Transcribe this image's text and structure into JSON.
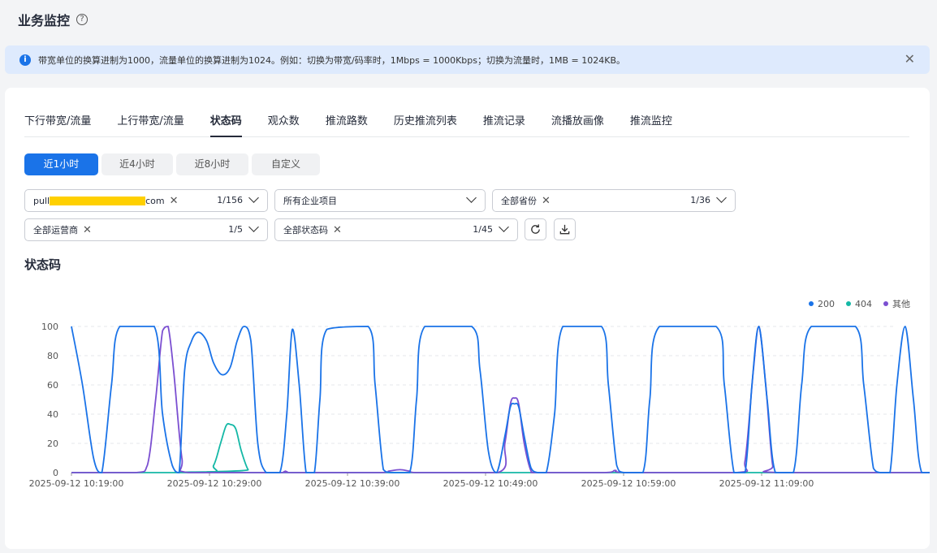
{
  "header": {
    "title": "业务监控",
    "help_icon": "?"
  },
  "notice": {
    "text": "带宽单位的换算进制为1000，流量单位的换算进制为1024。例如：切换为带宽/码率时，1Mbps = 1000Kbps；切换为流量时，1MB = 1024KB。",
    "info_icon": "i",
    "close_icon": "✕"
  },
  "tabs": [
    "下行带宽/流量",
    "上行带宽/流量",
    "状态码",
    "观众数",
    "推流路数",
    "历史推流列表",
    "推流记录",
    "流播放画像",
    "推流监控"
  ],
  "active_tab": "状态码",
  "time_range": {
    "options": [
      "近1小时",
      "近4小时",
      "近8小时",
      "自定义"
    ],
    "active": "近1小时"
  },
  "filters": {
    "domain": {
      "prefix": "pull",
      "suffix": "com",
      "count": "1/156"
    },
    "project": {
      "value": "所有企业项目"
    },
    "province": {
      "value": "全部省份",
      "count": "1/36"
    },
    "isp": {
      "value": "全部运营商",
      "count": "1/5"
    },
    "status_code": {
      "value": "全部状态码",
      "count": "1/45"
    },
    "remove_icon": "✕"
  },
  "chart_title": "状态码",
  "chart_data": {
    "type": "line",
    "ylim": [
      0,
      100
    ],
    "y_ticks": [
      "0",
      "20",
      "40",
      "60",
      "80",
      "100"
    ],
    "x_tick_labels": [
      "2025-09-12 10:19:00",
      "2025-09-12 10:29:00",
      "2025-09-12 10:39:00",
      "2025-09-12 10:49:00",
      "2025-09-12 10:59:00",
      "2025-09-12 11:09:00"
    ],
    "x_minutes_range": [
      0,
      60
    ],
    "grid": "horizontal dashed",
    "legend_position": "top-right",
    "series": [
      {
        "name": "200",
        "color": "#1a73e8",
        "points": [
          [
            0,
            100
          ],
          [
            0.8,
            60
          ],
          [
            1.6,
            10
          ],
          [
            2.2,
            0
          ],
          [
            2.9,
            60
          ],
          [
            3.5,
            100
          ],
          [
            6,
            100
          ],
          [
            6.6,
            40
          ],
          [
            7.3,
            5
          ],
          [
            7.8,
            0
          ],
          [
            8.2,
            70
          ],
          [
            8.7,
            90
          ],
          [
            9.2,
            96
          ],
          [
            9.8,
            90
          ],
          [
            10.3,
            75
          ],
          [
            10.9,
            67
          ],
          [
            11.5,
            72
          ],
          [
            12,
            90
          ],
          [
            12.5,
            100
          ],
          [
            13,
            90
          ],
          [
            13.5,
            20
          ],
          [
            14.1,
            0
          ],
          [
            15.1,
            0
          ],
          [
            15.6,
            40
          ],
          [
            16,
            98
          ],
          [
            16.5,
            60
          ],
          [
            17,
            0
          ],
          [
            17.6,
            0
          ],
          [
            18,
            50
          ],
          [
            18.5,
            98
          ],
          [
            21.5,
            100
          ],
          [
            22,
            60
          ],
          [
            22.6,
            2
          ],
          [
            23.2,
            0
          ],
          [
            24.5,
            0
          ],
          [
            25,
            50
          ],
          [
            25.6,
            100
          ],
          [
            29,
            100
          ],
          [
            29.6,
            70
          ],
          [
            30.2,
            15
          ],
          [
            30.8,
            0
          ],
          [
            31.4,
            25
          ],
          [
            31.8,
            45
          ],
          [
            32.1,
            47
          ],
          [
            32.4,
            45
          ],
          [
            32.8,
            25
          ],
          [
            33.3,
            3
          ],
          [
            33.8,
            0
          ],
          [
            34.4,
            0
          ],
          [
            35,
            40
          ],
          [
            35.6,
            100
          ],
          [
            38.4,
            100
          ],
          [
            38.9,
            60
          ],
          [
            39.5,
            5
          ],
          [
            40,
            0
          ],
          [
            41.4,
            0
          ],
          [
            41.9,
            50
          ],
          [
            42.6,
            100
          ],
          [
            46.7,
            100
          ],
          [
            47.3,
            60
          ],
          [
            48,
            0
          ],
          [
            48.8,
            0
          ],
          [
            49.3,
            60
          ],
          [
            49.8,
            100
          ],
          [
            50.4,
            50
          ],
          [
            51,
            0
          ],
          [
            52.3,
            0
          ],
          [
            52.9,
            60
          ],
          [
            53.6,
            100
          ],
          [
            56.8,
            100
          ],
          [
            57.4,
            60
          ],
          [
            58.1,
            3
          ],
          [
            58.6,
            0
          ],
          [
            59.3,
            0
          ],
          [
            59.8,
            60
          ],
          [
            60.4,
            100
          ],
          [
            61,
            50
          ],
          [
            61.6,
            0
          ],
          [
            63,
            0
          ],
          [
            63.5,
            50
          ],
          [
            64.2,
            100
          ],
          [
            67.7,
            100
          ],
          [
            68.3,
            50
          ],
          [
            68.9,
            0
          ],
          [
            70.3,
            0
          ],
          [
            70.8,
            25
          ],
          [
            71.2,
            45
          ],
          [
            71.5,
            47
          ],
          [
            71.8,
            45
          ],
          [
            72.2,
            25
          ],
          [
            72.6,
            3
          ],
          [
            73.2,
            0
          ],
          [
            74,
            0
          ],
          [
            74.5,
            60
          ],
          [
            75.2,
            100
          ],
          [
            78,
            100
          ],
          [
            78.6,
            60
          ],
          [
            79.1,
            5
          ],
          [
            79.6,
            0
          ],
          [
            80.6,
            0
          ],
          [
            81.2,
            60
          ],
          [
            81.9,
            98
          ],
          [
            82.5,
            100
          ],
          [
            83,
            80
          ],
          [
            83.5,
            20
          ],
          [
            84,
            0
          ],
          [
            84.7,
            0
          ],
          [
            85.2,
            0
          ]
        ]
      },
      {
        "name": "404",
        "color": "#14b8a6",
        "points": [
          [
            0,
            0
          ],
          [
            9.6,
            0
          ],
          [
            10.3,
            5
          ],
          [
            10.8,
            20
          ],
          [
            11.2,
            32
          ],
          [
            11.5,
            33
          ],
          [
            11.9,
            30
          ],
          [
            12.3,
            15
          ],
          [
            12.8,
            2
          ],
          [
            13.3,
            0
          ],
          [
            85.2,
            0
          ]
        ]
      },
      {
        "name": "其他",
        "color": "#7b4fd1",
        "points": [
          [
            0,
            0
          ],
          [
            4.6,
            0
          ],
          [
            5.5,
            5
          ],
          [
            6.1,
            50
          ],
          [
            6.6,
            97
          ],
          [
            7,
            100
          ],
          [
            7.4,
            70
          ],
          [
            8,
            10
          ],
          [
            8.5,
            0
          ],
          [
            15,
            0
          ],
          [
            15.5,
            1
          ],
          [
            16,
            0
          ],
          [
            22.3,
            0
          ],
          [
            23,
            1
          ],
          [
            23.8,
            2
          ],
          [
            24.5,
            1
          ],
          [
            25.2,
            0
          ],
          [
            30.9,
            0
          ],
          [
            31.4,
            20
          ],
          [
            31.8,
            47
          ],
          [
            32.1,
            51
          ],
          [
            32.4,
            47
          ],
          [
            32.8,
            20
          ],
          [
            33.3,
            1
          ],
          [
            33.8,
            0
          ],
          [
            38.6,
            0
          ],
          [
            39.4,
            1.5
          ],
          [
            40.3,
            0
          ],
          [
            48.2,
            0
          ],
          [
            48.8,
            8
          ],
          [
            49.4,
            70
          ],
          [
            49.8,
            100
          ],
          [
            50.3,
            60
          ],
          [
            50.8,
            5
          ],
          [
            51.3,
            0
          ],
          [
            65.3,
            0
          ],
          [
            66,
            1.5
          ],
          [
            66.6,
            1
          ],
          [
            67.3,
            0
          ],
          [
            70.8,
            0
          ],
          [
            71.2,
            20
          ],
          [
            71.5,
            45
          ],
          [
            71.7,
            52
          ],
          [
            72,
            45
          ],
          [
            72.4,
            20
          ],
          [
            72.9,
            1
          ],
          [
            73.4,
            0
          ],
          [
            80.7,
            0
          ],
          [
            81.3,
            1
          ],
          [
            81.9,
            1.5
          ],
          [
            82.6,
            0
          ],
          [
            85.2,
            0
          ]
        ]
      }
    ]
  }
}
